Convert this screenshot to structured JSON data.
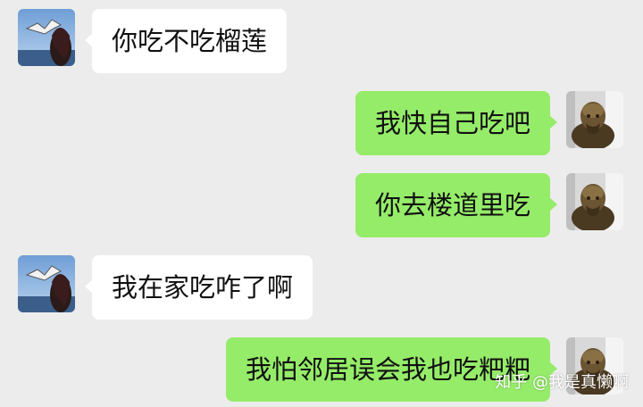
{
  "messages": [
    {
      "side": "left",
      "text": "你吃不吃榴莲"
    },
    {
      "side": "right",
      "text": "我快自己吃吧"
    },
    {
      "side": "right",
      "text": "你去楼道里吃"
    },
    {
      "side": "left",
      "text": "我在家吃咋了啊"
    },
    {
      "side": "right",
      "text": "我怕邻居误会我也吃粑粑"
    }
  ],
  "watermark": "知乎 @我是真懒啊",
  "avatars": {
    "left_icon": "profile-photo-seagull-girl-icon",
    "right_icon": "profile-photo-statue-icon"
  },
  "colors": {
    "background": "#ececec",
    "sent_bubble": "#95ec69",
    "received_bubble": "#ffffff",
    "text": "#111111"
  }
}
